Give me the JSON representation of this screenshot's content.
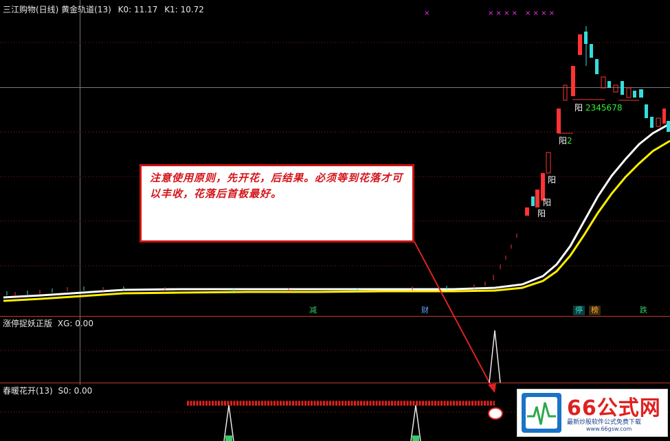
{
  "main_panel": {
    "title": "三江购物(日线) 黄金轨道(13)",
    "k0_label": "K0:",
    "k0_value": "11.17",
    "k1_label": "K1:",
    "k1_value": "10.72"
  },
  "annotation": {
    "text": "注意使用原则，先开花，后结果。必须等到花落才可以丰收，花落后首板最好。"
  },
  "signals": [
    {
      "text": "减",
      "color": "#33cc66"
    },
    {
      "text": "财",
      "color": "#66aaff"
    },
    {
      "text": "停",
      "color": "#33ddcc"
    },
    {
      "text": "榜",
      "color": "#ffaa33"
    },
    {
      "text": "跌",
      "color": "#33cc66"
    }
  ],
  "yang_labels": {
    "yang1": "阳",
    "yang2": "阳",
    "yang3": "阳",
    "yang4_prefix": "阳",
    "yang4_num": "2",
    "yang5_prefix": "阳",
    "yang5_num": "2345678"
  },
  "cross_marks": {
    "single": "×",
    "group1": "× × × ×",
    "group2": "× × × ×"
  },
  "indicator1": {
    "title": "涨停捉妖正版",
    "label": "XG:",
    "value": "0.00"
  },
  "indicator2": {
    "title": "春暖花开(13)",
    "label": "S0:",
    "value": "0.00"
  },
  "watermark": {
    "brand": "66公式网",
    "tagline": "最新炒股软件公式免费下载",
    "url": "www.66gsw.com"
  },
  "colors": {
    "background": "#000000",
    "panel_divider": "#c0392b",
    "up_candle": "#ff3333",
    "down_candle": "#33dddd",
    "track_upper": "#ffffff",
    "track_lower": "#ffee00",
    "annotation_border": "#cc1111",
    "annotation_text": "#d4141a",
    "bead_row": "#dd2222"
  }
}
